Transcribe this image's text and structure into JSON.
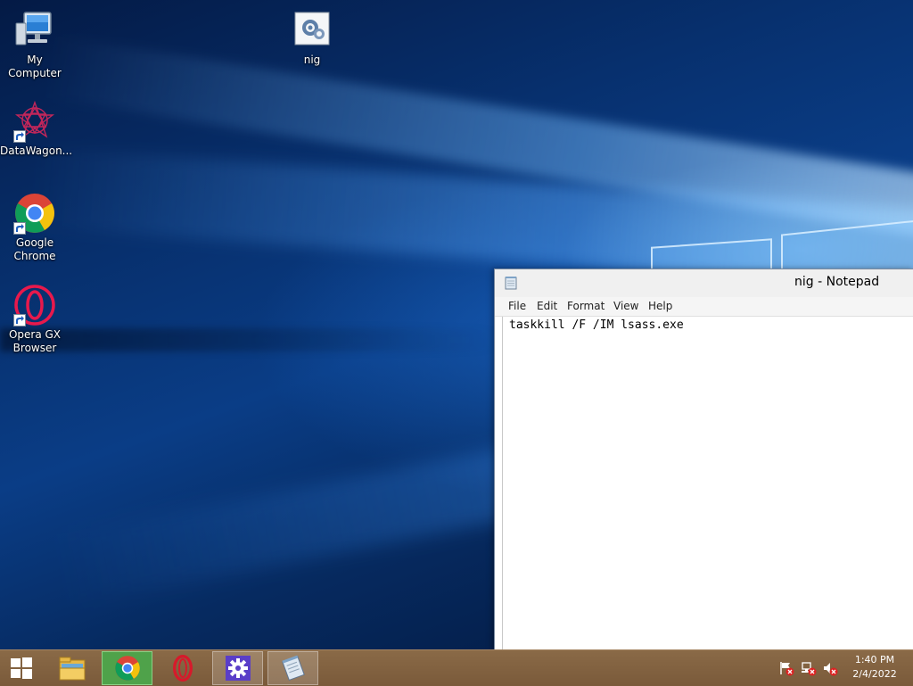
{
  "desktop": {
    "icons": [
      {
        "label": "My Computer",
        "icon": "computer-icon"
      },
      {
        "label": "nig",
        "icon": "settings-file-icon"
      },
      {
        "label": "DataWagon...",
        "icon": "datawagon-icon"
      },
      {
        "label": "Google Chrome",
        "icon": "chrome-icon"
      },
      {
        "label": "Opera GX Browser",
        "icon": "opera-gx-icon"
      }
    ]
  },
  "notepad": {
    "title": "nig - Notepad",
    "menu": [
      "File",
      "Edit",
      "Format",
      "View",
      "Help"
    ],
    "content": "taskkill /F /IM lsass.exe"
  },
  "taskbar": {
    "apps": [
      {
        "name": "start-icon",
        "active": false
      },
      {
        "name": "file-explorer-icon",
        "active": false
      },
      {
        "name": "chrome-icon",
        "active": true
      },
      {
        "name": "opera-icon",
        "active": false
      },
      {
        "name": "settings-icon",
        "active": true
      },
      {
        "name": "notepad-icon",
        "active": true
      }
    ],
    "tray": [
      "action-center-flag-icon",
      "network-icon",
      "volume-muted-icon"
    ],
    "clock": {
      "time": "1:40 PM",
      "date": "2/4/2022"
    }
  },
  "colors": {
    "taskbar": "#7a5a3a",
    "chrome_active": "#4fa24a"
  }
}
